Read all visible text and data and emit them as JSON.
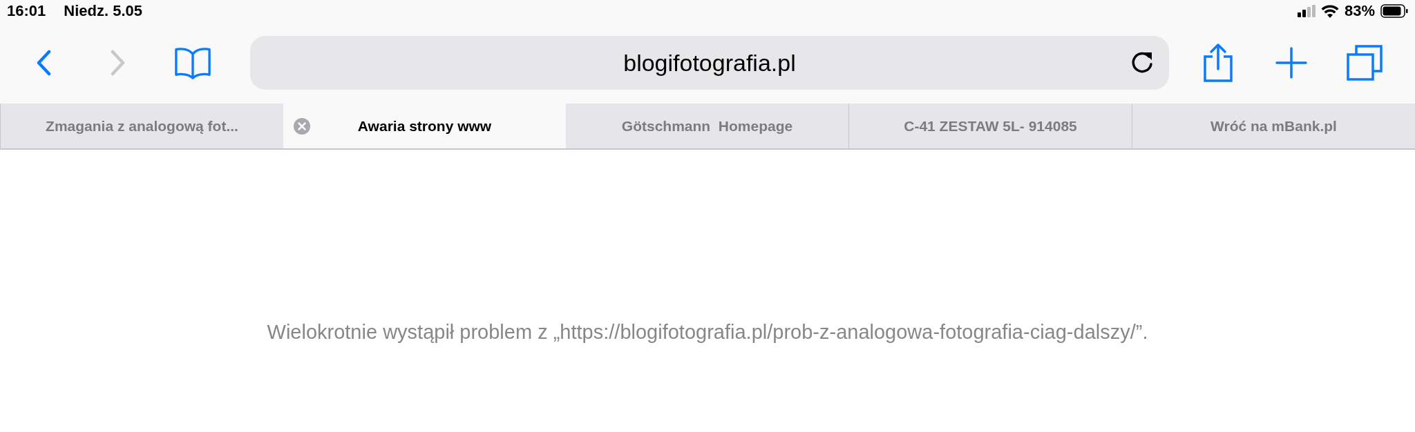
{
  "status_bar": {
    "time": "16:01",
    "date": "Niedz. 5.05",
    "battery": "83%"
  },
  "toolbar": {
    "back_disabled": false,
    "forward_disabled": true,
    "address": "blogifotografia.pl"
  },
  "tabs": [
    {
      "title": "Zmagania z analogową fot...",
      "selected": false
    },
    {
      "title": "Awaria strony www",
      "selected": true
    },
    {
      "title": "Götschmann  Homepage",
      "selected": false
    },
    {
      "title": "C-41 ZESTAW 5L- 914085",
      "selected": false
    },
    {
      "title": "Wróć na mBank.pl",
      "selected": false
    }
  ],
  "page": {
    "message": "Wielokrotnie wystąpił problem z „https://blogifotografia.pl/prob-z-analogowa-fotografia-ciag-dalszy/”."
  }
}
